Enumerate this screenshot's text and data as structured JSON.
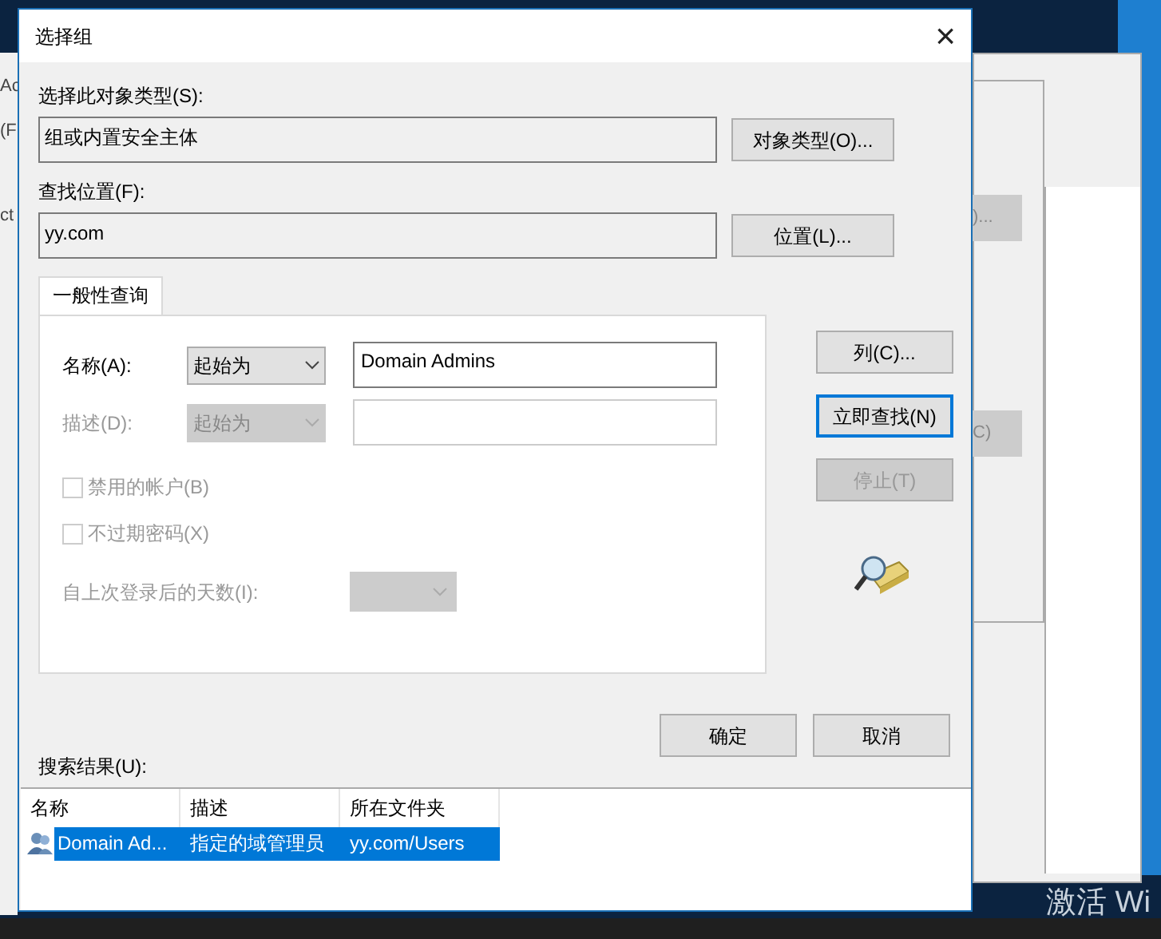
{
  "background_windows": [
    {
      "fragments": [
        "Ac",
        "(F",
        "ct"
      ]
    },
    {
      "fragments": [
        ")...",
        "C)"
      ]
    }
  ],
  "dialog": {
    "title": "选择组",
    "close": "×",
    "object_type": {
      "label": "选择此对象类型(S):",
      "value": "组或内置安全主体",
      "button": "对象类型(O)..."
    },
    "location": {
      "label": "查找位置(F):",
      "value": "yy.com",
      "button": "位置(L)..."
    },
    "tabs": [
      {
        "label": "一般性查询",
        "selected": true
      }
    ],
    "query": {
      "name": {
        "label": "名称(A):",
        "operator": "起始为",
        "value": "Domain Admins",
        "disabled": false
      },
      "description": {
        "label": "描述(D):",
        "operator": "起始为",
        "disabled": true
      },
      "checkboxes": [
        {
          "label": "禁用的帐户(B)",
          "checked": false,
          "disabled": true
        },
        {
          "label": "不过期密码(X)",
          "checked": false,
          "disabled": true
        }
      ],
      "days": {
        "label": "自上次登录后的天数(I):",
        "disabled": true
      }
    },
    "side_buttons": [
      {
        "label": "列(C)...",
        "focused": false,
        "disabled": false
      },
      {
        "label": "立即查找(N)",
        "focused": true,
        "disabled": false
      },
      {
        "label": "停止(T)",
        "focused": false,
        "disabled": true
      }
    ],
    "buttons": [
      {
        "label": "确定"
      },
      {
        "label": "取消"
      }
    ],
    "results": {
      "label": "搜索结果(U):",
      "columns": [
        "名称",
        "描述",
        "所在文件夹"
      ],
      "rows": [
        {
          "cells": [
            "Domain Ad...",
            "指定的域管理员",
            "yy.com/Users"
          ],
          "selected": true
        }
      ]
    }
  },
  "watermark_text": "激活 Wi"
}
